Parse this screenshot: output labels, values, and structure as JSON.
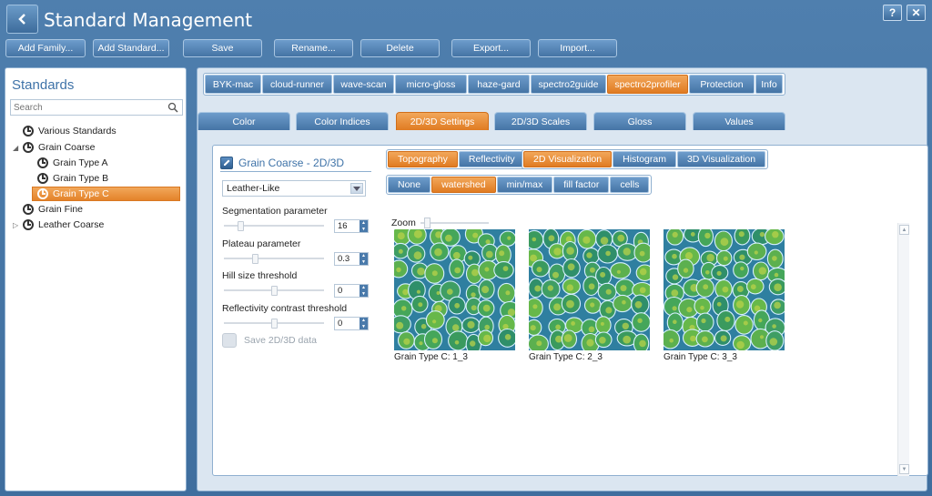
{
  "window": {
    "title": "Standard Management",
    "help_label": "?",
    "close_label": "✕"
  },
  "toolbar": {
    "add_family": "Add Family...",
    "add_standard": "Add Standard...",
    "save": "Save",
    "rename": "Rename...",
    "delete": "Delete",
    "export": "Export...",
    "import": "Import..."
  },
  "sidebar": {
    "heading": "Standards",
    "search_placeholder": "Search",
    "items": [
      {
        "label": "Various Standards",
        "level": 0,
        "expander": "",
        "selected": false
      },
      {
        "label": "Grain Coarse",
        "level": 0,
        "expander": "◢",
        "selected": false
      },
      {
        "label": "Grain Type A",
        "level": 1,
        "expander": "",
        "selected": false
      },
      {
        "label": "Grain Type B",
        "level": 1,
        "expander": "",
        "selected": false
      },
      {
        "label": "Grain Type C",
        "level": 1,
        "expander": "",
        "selected": true
      },
      {
        "label": "Grain Fine",
        "level": 0,
        "expander": "",
        "selected": false
      },
      {
        "label": "Leather Coarse",
        "level": 0,
        "expander": "▷",
        "selected": false
      }
    ]
  },
  "device_tabs": [
    "BYK-mac",
    "cloud-runner",
    "wave-scan",
    "micro-gloss",
    "haze-gard",
    "spectro2guide",
    "spectro2profiler",
    "Protection",
    "Info"
  ],
  "device_tab_active": "spectro2profiler",
  "sub_tabs": [
    "Color",
    "Color Indices",
    "2D/3D Settings",
    "2D/3D Scales",
    "Gloss",
    "Values"
  ],
  "sub_tab_active": "2D/3D Settings",
  "settings": {
    "title": "Grain Coarse - 2D/3D",
    "preset": "Leather-Like",
    "params": [
      {
        "label": "Segmentation parameter",
        "value": "16",
        "level": 0.15
      },
      {
        "label": "Plateau parameter",
        "value": "0.3",
        "level": 0.3
      },
      {
        "label": "Hill size threshold",
        "value": "0",
        "level": 0.5
      },
      {
        "label": "Reflectivity contrast threshold",
        "value": "0",
        "level": 0.5
      }
    ],
    "save_label": "Save 2D/3D data"
  },
  "mode_toggle": {
    "options": [
      "Topography",
      "Reflectivity"
    ],
    "active": "Topography"
  },
  "view_toggle": {
    "options": [
      "2D Visualization",
      "Histogram",
      "3D Visualization"
    ],
    "active": "2D Visualization"
  },
  "overlay_toggle": {
    "options": [
      "None",
      "watershed",
      "min/max",
      "fill factor",
      "cells"
    ],
    "active": "watershed"
  },
  "zoom_label": "Zoom",
  "images": [
    {
      "caption": "Grain Type C: 1_3"
    },
    {
      "caption": "Grain Type C: 2_3"
    },
    {
      "caption": "Grain Type C: 3_3"
    }
  ],
  "colors": {
    "accent_orange": "#e4832a",
    "button_blue": "#4f7fae",
    "heading_blue": "#3f73a8"
  }
}
